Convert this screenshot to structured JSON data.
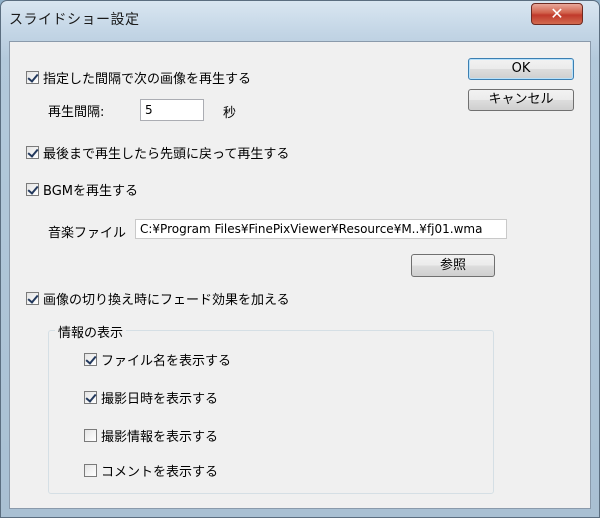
{
  "window": {
    "title": "スライドショー設定",
    "close_glyph": "✕"
  },
  "buttons": {
    "ok": "OK",
    "cancel": "キャンセル",
    "browse": "参照"
  },
  "interval": {
    "checkbox_label": "指定した間隔で次の画像を再生する",
    "checked": true,
    "field_label": "再生間隔:",
    "value": "5",
    "unit": "秒"
  },
  "loop": {
    "label": "最後まで再生したら先頭に戻って再生する",
    "checked": true
  },
  "bgm": {
    "label": "BGMを再生する",
    "checked": true,
    "file_label": "音楽ファイル",
    "file_path": "C:¥Program Files¥FinePixViewer¥Resource¥M..¥fj01.wma"
  },
  "fade": {
    "label": "画像の切り換え時にフェード効果を加える",
    "checked": true
  },
  "info_group": {
    "title": "情報の表示",
    "items": [
      {
        "label": "ファイル名を表示する",
        "checked": true
      },
      {
        "label": "撮影日時を表示する",
        "checked": true
      },
      {
        "label": "撮影情報を表示する",
        "checked": false
      },
      {
        "label": "コメントを表示する",
        "checked": false
      }
    ]
  },
  "icons": {
    "checkbox_checked": "checkmark-icon"
  }
}
